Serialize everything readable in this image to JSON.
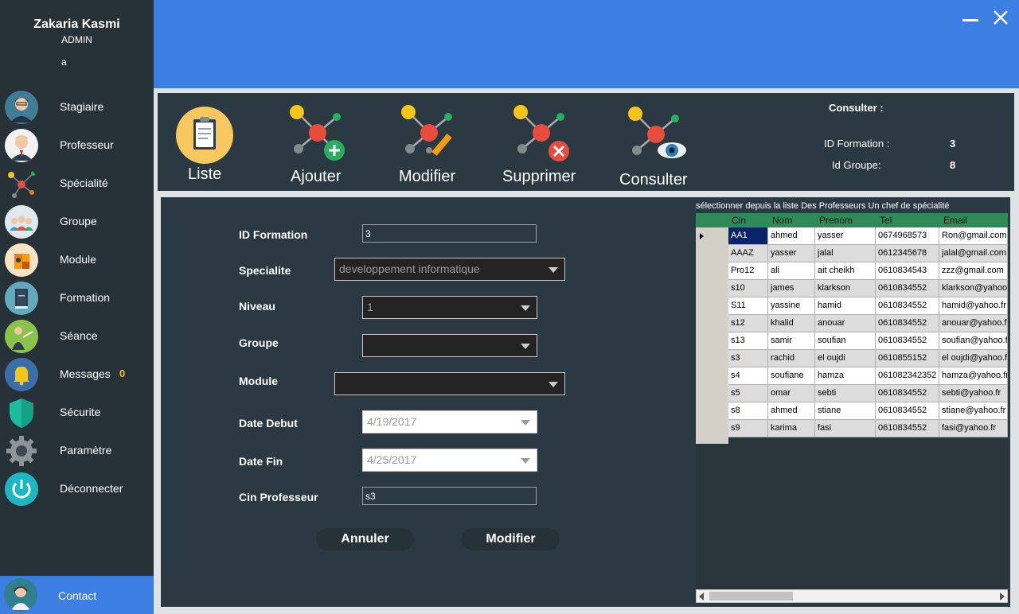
{
  "user": {
    "name": "Zakaria Kasmi",
    "role": "ADMIN",
    "extra": "a"
  },
  "sidebar": {
    "items": [
      {
        "label": "Stagiaire",
        "icon": "student-avatar-icon"
      },
      {
        "label": "Professeur",
        "icon": "professor-avatar-icon"
      },
      {
        "label": "Spécialité",
        "icon": "molecule-icon"
      },
      {
        "label": "Groupe",
        "icon": "group-icon"
      },
      {
        "label": "Module",
        "icon": "puzzle-icon"
      },
      {
        "label": "Formation",
        "icon": "book-icon"
      },
      {
        "label": "Séance",
        "icon": "teacher-board-icon"
      },
      {
        "label": "Messages",
        "icon": "bell-icon",
        "badge": "0"
      },
      {
        "label": "Sécurite",
        "icon": "shield-icon"
      },
      {
        "label": "Paramètre",
        "icon": "gear-icon"
      },
      {
        "label": "Déconnecter",
        "icon": "power-icon"
      }
    ],
    "contact": "Contact"
  },
  "toolbar": {
    "liste": "Liste",
    "ajouter": "Ajouter",
    "modifier": "Modifier",
    "supprimer": "Supprimer",
    "consulter": "Consulter"
  },
  "consult": {
    "title": "Consulter :",
    "id_formation_label": "ID Formation :",
    "id_formation_value": "3",
    "id_groupe_label": "Id Groupe:",
    "id_groupe_value": "8"
  },
  "form": {
    "id_formation": {
      "label": "ID Formation",
      "value": "3"
    },
    "specialite": {
      "label": "Specialite",
      "value": "developpement informatique"
    },
    "niveau": {
      "label": "Niveau",
      "value": "1"
    },
    "groupe": {
      "label": "Groupe",
      "value": ""
    },
    "module": {
      "label": "Module",
      "value": ""
    },
    "date_debut": {
      "label": "Date Debut",
      "value": "4/19/2017"
    },
    "date_fin": {
      "label": "Date Fin",
      "value": "4/25/2017"
    },
    "cin_professeur": {
      "label": "Cin Professeur",
      "value": "s3"
    },
    "annuler": "Annuler",
    "modifier": "Modifier"
  },
  "grid": {
    "caption": "sélectionner depuis la liste Des Professeurs Un chef de spécialité",
    "columns": [
      "Cin",
      "Nom",
      "Prenom",
      "Tel",
      "Email"
    ],
    "rows": [
      [
        "AA1",
        "ahmed",
        "yasser",
        "0674968573",
        "Ron@gmail.com"
      ],
      [
        "AAAZ",
        "yasser",
        "jalal",
        "0612345678",
        "jalal@gmail.com"
      ],
      [
        "Pro12",
        "ali",
        "ait cheikh",
        "0610834543",
        "zzz@gmail.com"
      ],
      [
        "s10",
        "james",
        "klarkson",
        "0610834552",
        "klarkson@yahoo.fr"
      ],
      [
        "S11",
        "yassine",
        "hamid",
        "0610834552",
        "hamid@yahoo.fr"
      ],
      [
        "s12",
        "khalid",
        "anouar",
        "0610834552",
        "anouar@yahoo.fr"
      ],
      [
        "s13",
        "samir",
        "soufian",
        "0610834552",
        "soufian@yahoo.fr"
      ],
      [
        "s3",
        "rachid",
        "el oujdi",
        "0610855152",
        "el oujdi@yahoo.fr"
      ],
      [
        "s4",
        "soufiane",
        "hamza",
        "061082342352",
        "hamza@yahoo.fr"
      ],
      [
        "s5",
        "omar",
        "sebti",
        "0610834552",
        "sebti@yahoo.fr"
      ],
      [
        "s8",
        "ahmed",
        "stiane",
        "0610834552",
        "stiane@yahoo.fr"
      ],
      [
        "s9",
        "karima",
        "fasi",
        "0610834552",
        "fasi@yahoo.fr"
      ]
    ]
  }
}
